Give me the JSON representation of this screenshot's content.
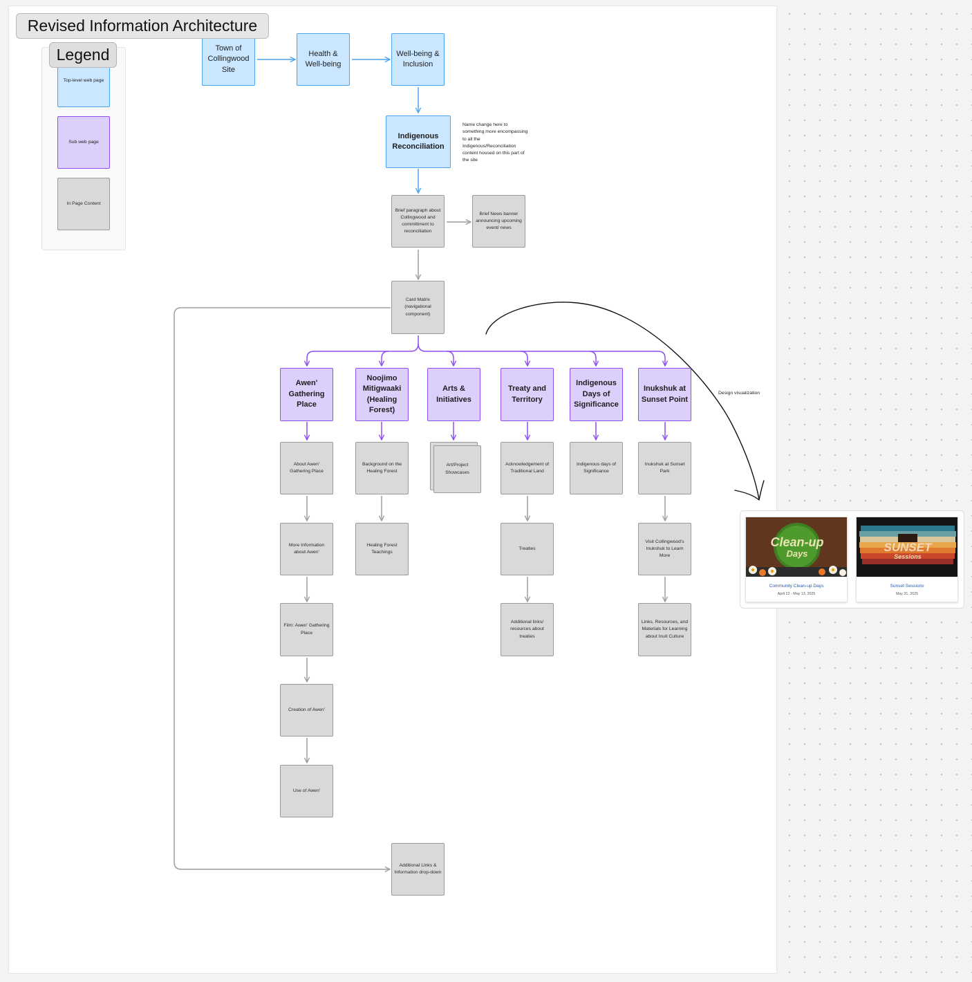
{
  "title": "Revised Information Architecture",
  "legend": {
    "title": "Legend",
    "items": [
      "Top-level web page",
      "Sub web page",
      "In Page Content"
    ]
  },
  "top_nav": [
    "Town of Collingwood Site",
    "Health & Well-being",
    "Well-being & Inclusion"
  ],
  "reconciliation": {
    "title": "Indigenous Reconciliation",
    "note": "Name change here to something more encompassing to all the Indigenous/Reconciliation content housed on this part of the site"
  },
  "content": {
    "brief_paragraph": "Brief paragraph about Collingwood and committment to reconciliation",
    "news_banner": "Brief News banner announcing upcoming event/ news",
    "card_matrix": "Card Matrix (navigational component)",
    "additional_links": "Additional Links & Information drop-down"
  },
  "subpages": [
    {
      "title": "Awen' Gathering Place",
      "items": [
        "About Awen' Gathering Place",
        "More Information about Awen'",
        "Film: Awen' Gathering Place",
        "Creation of Awen'",
        "Use of Awen'"
      ]
    },
    {
      "title": "Noojimo Mitigwaaki (Healing Forest)",
      "items": [
        "Background on the Healing Forest",
        "Healing Forest Teachings"
      ]
    },
    {
      "title": "Arts & Initiatives",
      "items": [
        "Art/Project Showcases"
      ]
    },
    {
      "title": "Treaty and Territory",
      "items": [
        "Acknowledgement of Traditional Land",
        "Treaties",
        "Additional links/ resources about treaties"
      ]
    },
    {
      "title": "Indigenous Days of Significance",
      "items": [
        "Indigenous days of Significance"
      ]
    },
    {
      "title": "Inukshuk at Sunset Point",
      "items": [
        "Inukshuk at Sunset Park",
        "Visit Collingwood's Inukshuk to Learn More",
        "Links, Resources, and Materials for Learning about Inuit Culture"
      ]
    }
  ],
  "design_label": "Design visualization",
  "preview_cards": [
    {
      "title": "Community Clean-up Days",
      "date": "April 22 - May 13, 2025",
      "image_text": [
        "Clean-up",
        "Days"
      ]
    },
    {
      "title": "Sunset Sessions",
      "date": "May 31, 2025",
      "image_text": [
        "SUNSET",
        "Sessions"
      ]
    }
  ],
  "colors": {
    "top_level_fill": "#cbe6ff",
    "top_level_stroke": "#4aa3ec",
    "sub_fill": "#dccffb",
    "sub_stroke": "#8d4df0",
    "content_fill": "#d9d9d9",
    "content_stroke": "#9a9a9a",
    "connector_gray": "#9e9e9e",
    "connector_blue": "#4aa3ec",
    "connector_purple": "#8d4df0"
  }
}
